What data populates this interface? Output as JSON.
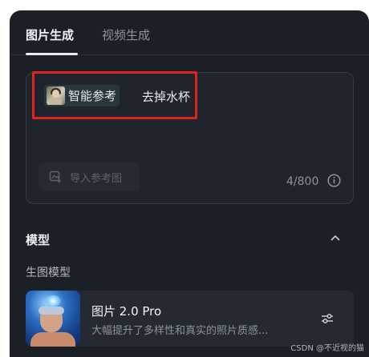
{
  "tabs": [
    {
      "label": "图片生成",
      "active": true
    },
    {
      "label": "视频生成",
      "active": false
    }
  ],
  "prompt": {
    "reference_chip_label": "智能参考",
    "text": "去掉水杯",
    "import_button_label": "导入参考图",
    "char_count": "4/800"
  },
  "model_section": {
    "title": "模型",
    "subtitle": "生图模型",
    "model_name": "图片 2.0 Pro",
    "model_description": "大幅提升了多样性和真实的照片质感..."
  },
  "watermark": "CSDN @不近视的猫",
  "colors": {
    "background": "#1b1f26",
    "highlight_border": "#e0231c"
  }
}
